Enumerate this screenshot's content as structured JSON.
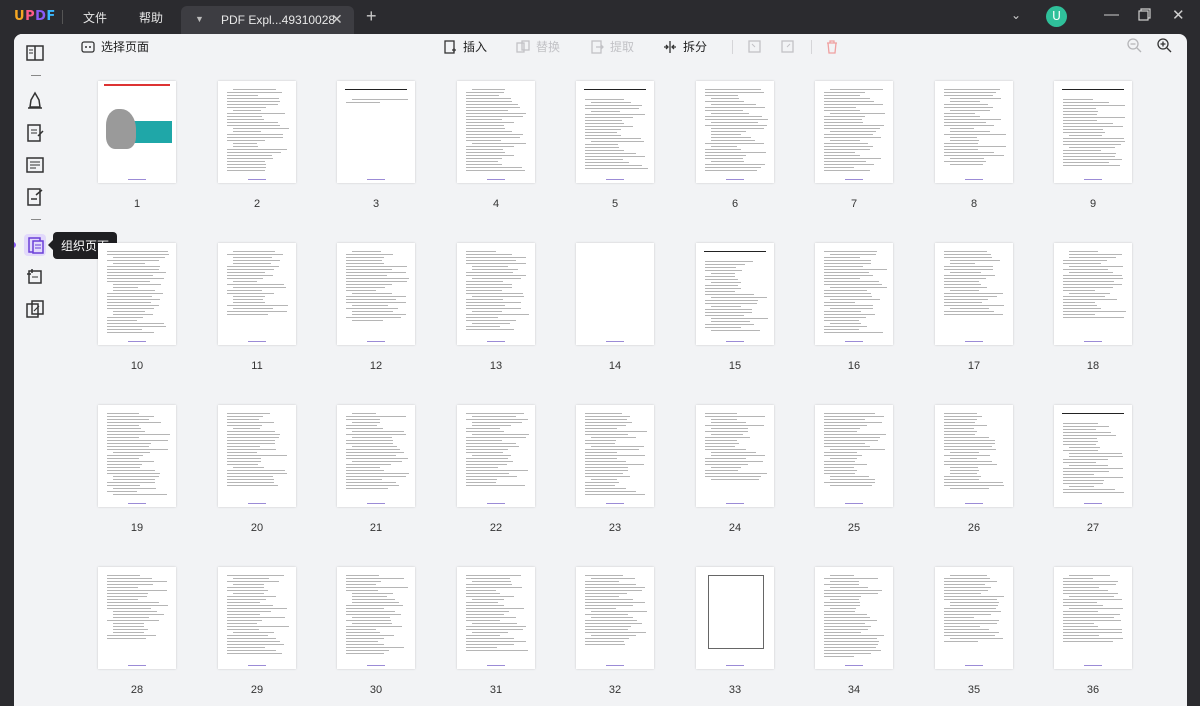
{
  "app": {
    "logo": "UPDF",
    "logo_colors": [
      "#f5a623",
      "#ff5a8a",
      "#8a5cf6",
      "#39b8ff"
    ],
    "menu": [
      "文件",
      "帮助"
    ],
    "tab_title": "PDF Expl...49310028",
    "user_initial": "U",
    "accent": "#8a5cf6",
    "avatar_color": "#2fc09a"
  },
  "window_controls": [
    "chevron-down-icon",
    "minimize-icon",
    "restore-icon",
    "close-icon"
  ],
  "rail": {
    "items": [
      "reader-icon",
      "comment-icon",
      "edit-icon",
      "form-icon",
      "sign-icon",
      "organize-pages-icon",
      "crop-icon",
      "convert-icon"
    ],
    "active": "organize-pages-icon",
    "tooltip": "组织页面"
  },
  "toolbar": {
    "select_pages": "选择页面",
    "insert": "插入",
    "replace": "替换",
    "extract": "提取",
    "split": "拆分"
  },
  "pages": {
    "count": 36,
    "labels": [
      "1",
      "2",
      "3",
      "4",
      "5",
      "6",
      "7",
      "8",
      "9",
      "10",
      "11",
      "12",
      "13",
      "14",
      "15",
      "16",
      "17",
      "18",
      "19",
      "20",
      "21",
      "22",
      "23",
      "24",
      "25",
      "26",
      "27",
      "28",
      "29",
      "30",
      "31",
      "32",
      "33",
      "34",
      "35",
      "36"
    ]
  }
}
